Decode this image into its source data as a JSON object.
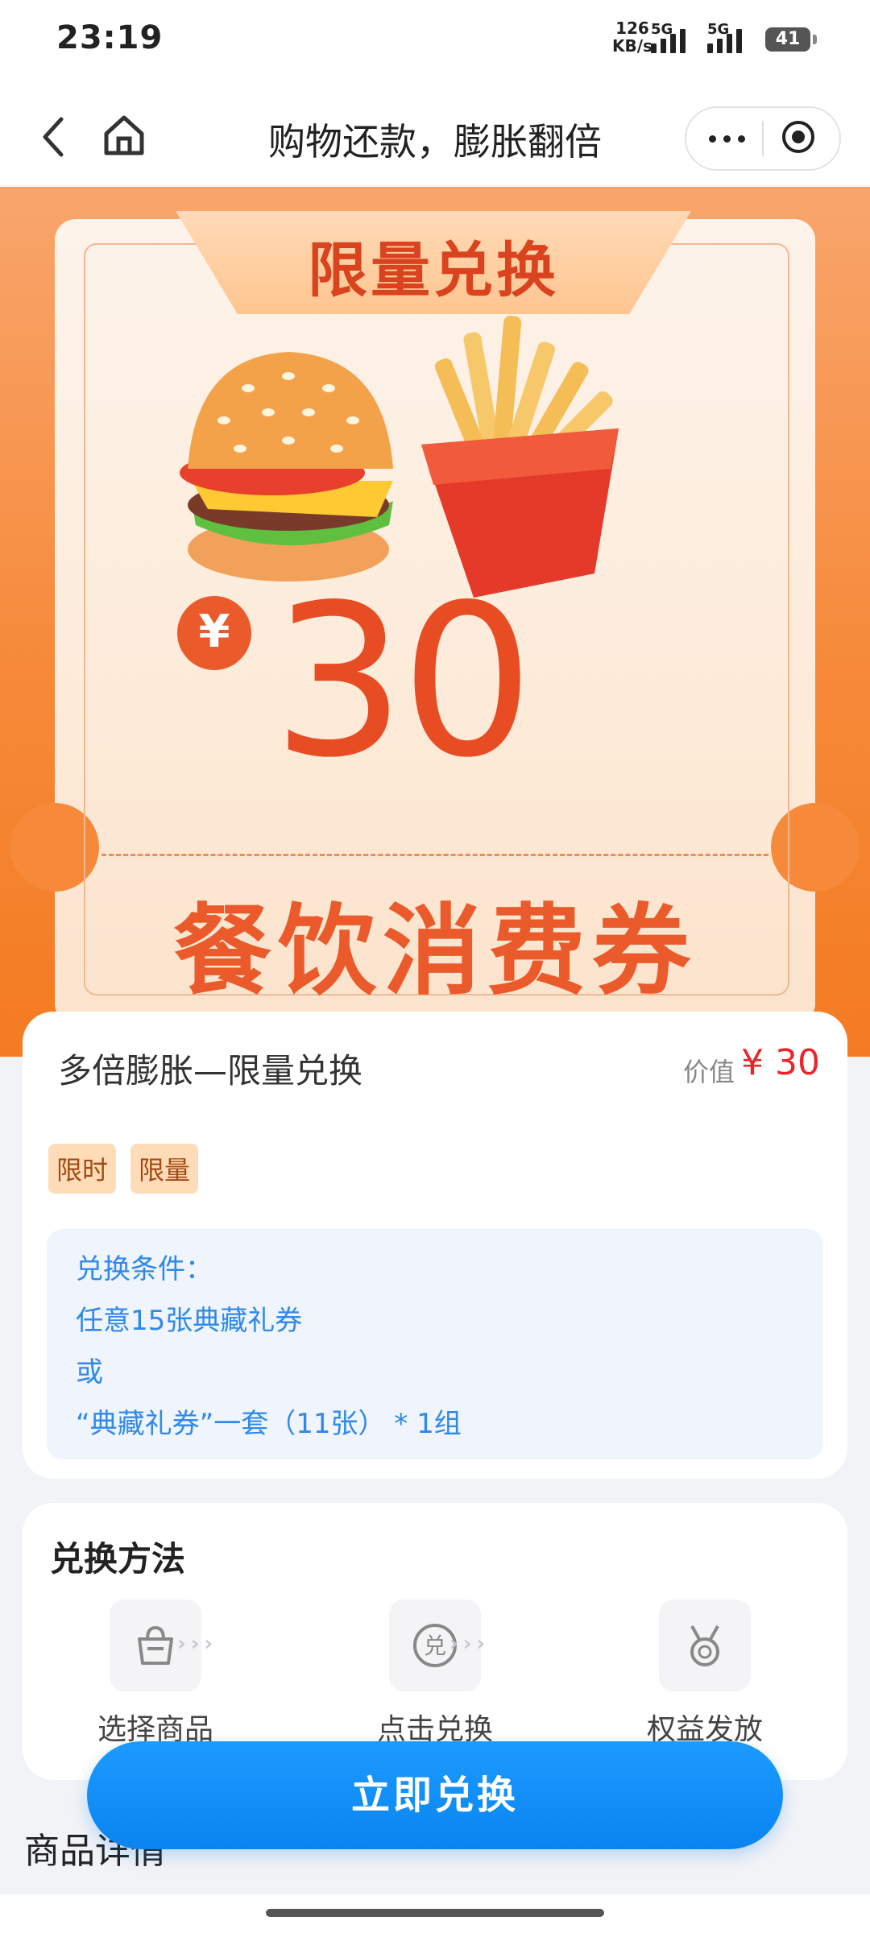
{
  "status": {
    "time": "23:19",
    "net_speed_value": "126",
    "net_speed_unit": "KB/s",
    "sim1": "5G",
    "sim2": "5G",
    "battery": "41"
  },
  "nav": {
    "title": "购物还款，膨胀翻倍"
  },
  "hero": {
    "badge": "限量兑换",
    "currency": "¥",
    "amount": "30",
    "voucher_name": "餐饮消费券"
  },
  "product": {
    "title": "多倍膨胀—限量兑换",
    "value_label": "价值",
    "value": "¥ 30",
    "tags": [
      "限时",
      "限量"
    ],
    "conditions": [
      "兑换条件：",
      "任意15张典藏礼券",
      "或",
      "“典藏礼券”一套（11张） * 1组"
    ]
  },
  "method": {
    "title": "兑换方法",
    "steps": [
      "选择商品",
      "点击兑换",
      "权益发放"
    ],
    "arrows": "›››"
  },
  "details": {
    "title": "商品详情"
  },
  "cta": {
    "label": "立即兑换"
  },
  "colors": {
    "accent_blue": "#0a84f0",
    "accent_orange": "#f68a3a",
    "price_red": "#e8262b",
    "condition_blue": "#2f89ea"
  }
}
